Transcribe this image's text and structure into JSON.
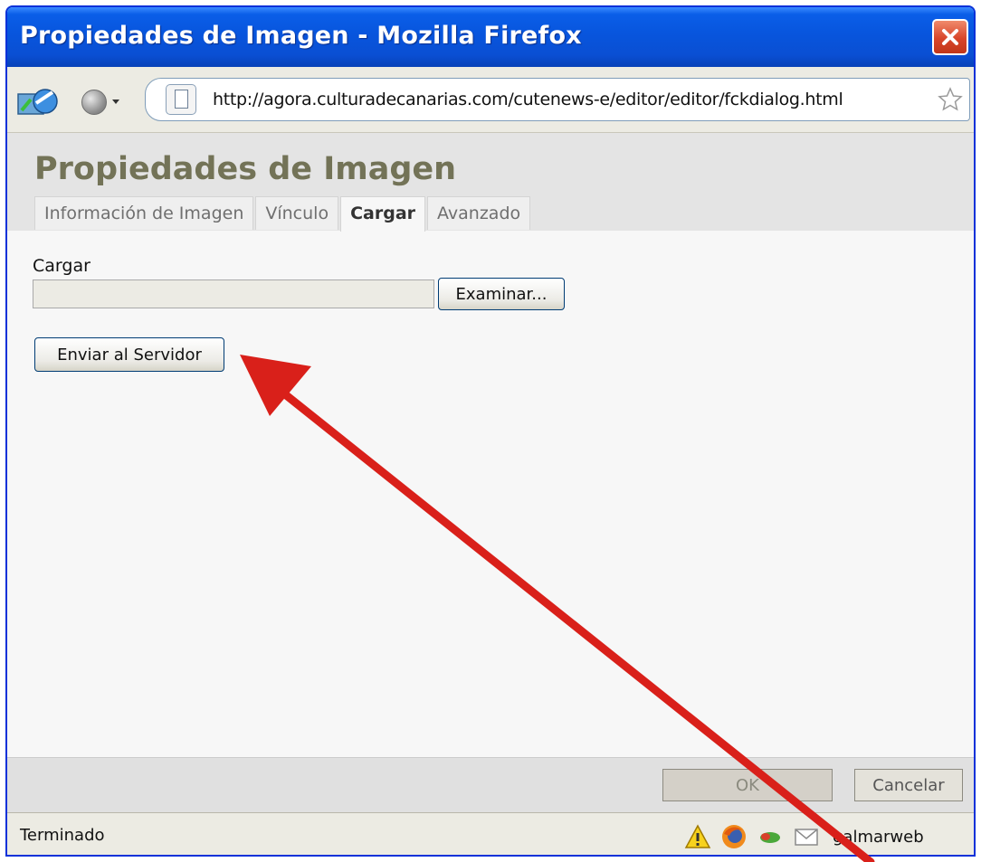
{
  "window": {
    "title": "Propiedades de Imagen - Mozilla Firefox"
  },
  "locationbar": {
    "url": "http://agora.culturadecanarias.com/cutenews-e/editor/editor/fckdialog.html"
  },
  "dialog": {
    "title": "Propiedades de Imagen",
    "tabs": [
      {
        "label": "Información de Imagen"
      },
      {
        "label": "Vínculo"
      },
      {
        "label": "Cargar"
      },
      {
        "label": "Avanzado"
      }
    ],
    "active_tab": "Cargar",
    "upload": {
      "label": "Cargar",
      "file_value": "",
      "browse_label": "Examinar...",
      "send_label": "Enviar al Servidor"
    },
    "footer": {
      "ok_label": "OK",
      "cancel_label": "Cancelar"
    }
  },
  "statusbar": {
    "text": "Terminado",
    "user": "galmarweb"
  },
  "colors": {
    "titlebar": "#0a5ee8",
    "dialog_title": "#737357",
    "arrow": "#d9201a"
  }
}
